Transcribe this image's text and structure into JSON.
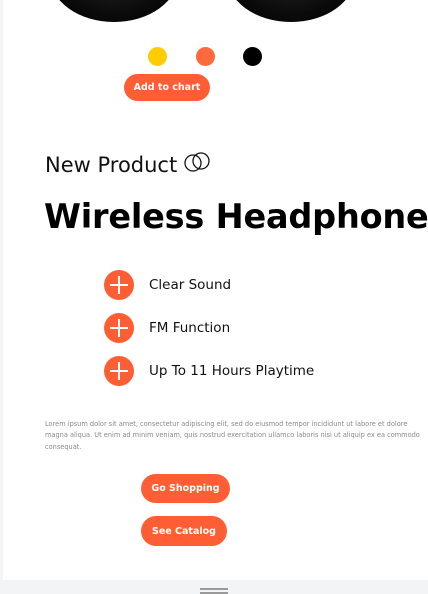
{
  "colors": {
    "accent": "#ff5e35",
    "swatches": [
      "#ffcc00",
      "#ff6a3d",
      "#000000"
    ]
  },
  "product": {
    "add_to_cart_label": "Add to chart",
    "eyebrow": "New Product",
    "eyebrow_icon": "rings-icon",
    "title": "Wireless Headphone",
    "features": [
      "Clear Sound",
      "FM Function",
      "Up To 11 Hours Playtime"
    ],
    "feature_icon": "plus-circle-icon",
    "description": "Lorem ipsum dolor sit amet, consectetur adipiscing elit, sed do eiusmod tempor incididunt ut labore et dolore magna aliqua. Ut enim ad minim veniam, quis nostrud exercitation ullamco laboris nisi ut aliquip ex ea commodo consequat.",
    "go_shopping_label": "Go Shopping",
    "see_catalog_label": "See Catalog"
  }
}
